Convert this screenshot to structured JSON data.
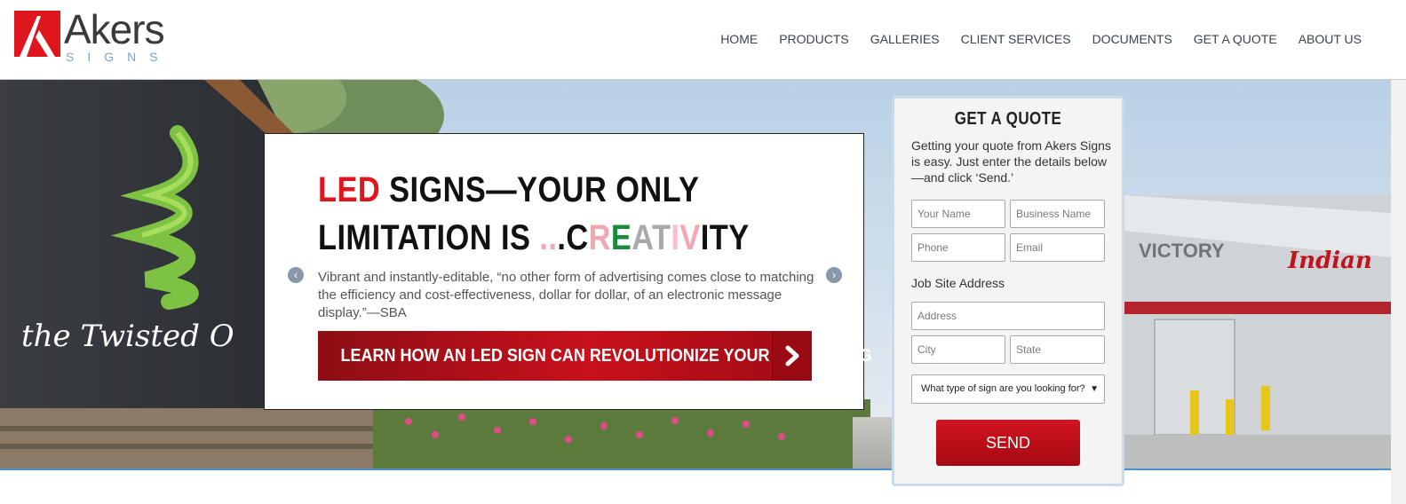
{
  "brand": {
    "name": "Akers",
    "sub": "SIGNS",
    "accent_color": "#e0161e"
  },
  "nav": {
    "items": [
      {
        "label": "HOME"
      },
      {
        "label": "PRODUCTS"
      },
      {
        "label": "GALLERIES"
      },
      {
        "label": "CLIENT SERVICES"
      },
      {
        "label": "DOCUMENTS"
      },
      {
        "label": "GET A QUOTE"
      },
      {
        "label": "ABOUT US"
      }
    ]
  },
  "slider": {
    "headline_led": "LED",
    "headline_part1": " SIGNS—YOUR ONLY",
    "headline_part2": "LIMITATION IS ",
    "headline_dots": "..",
    "headline_dot3": ".",
    "headline_c": "C",
    "headline_r": "R",
    "headline_e": "E",
    "headline_at": "AT",
    "headline_i": "I",
    "headline_v": "V",
    "headline_ity": "ITY",
    "body": "Vibrant and instantly-editable, “no other form of advertising comes close to matching the efficiency and cost-effectiveness, dollar for dollar, of an electronic message display.”—SBA",
    "cta_label": "LEARN HOW AN LED SIGN CAN REVOLUTIONIZE YOUR MESSAGING",
    "prev_icon": "chevron-left-icon",
    "next_icon": "chevron-right-icon"
  },
  "hero": {
    "sign_text": "the Twisted O",
    "victory_text": "VICTORY",
    "indian_text": "Indian"
  },
  "quote": {
    "title": "GET A QUOTE",
    "intro": "Getting your quote from Akers Signs is easy. Just enter the details below—and click ‘Send.’",
    "name_placeholder": "Your Name",
    "business_placeholder": "Business Name",
    "phone_placeholder": "Phone",
    "email_placeholder": "Email",
    "jobsite_label": "Job Site Address",
    "address_placeholder": "Address",
    "city_placeholder": "City",
    "state_placeholder": "State",
    "sign_type_selected": "What type of sign are you looking for?",
    "send_label": "SEND"
  }
}
